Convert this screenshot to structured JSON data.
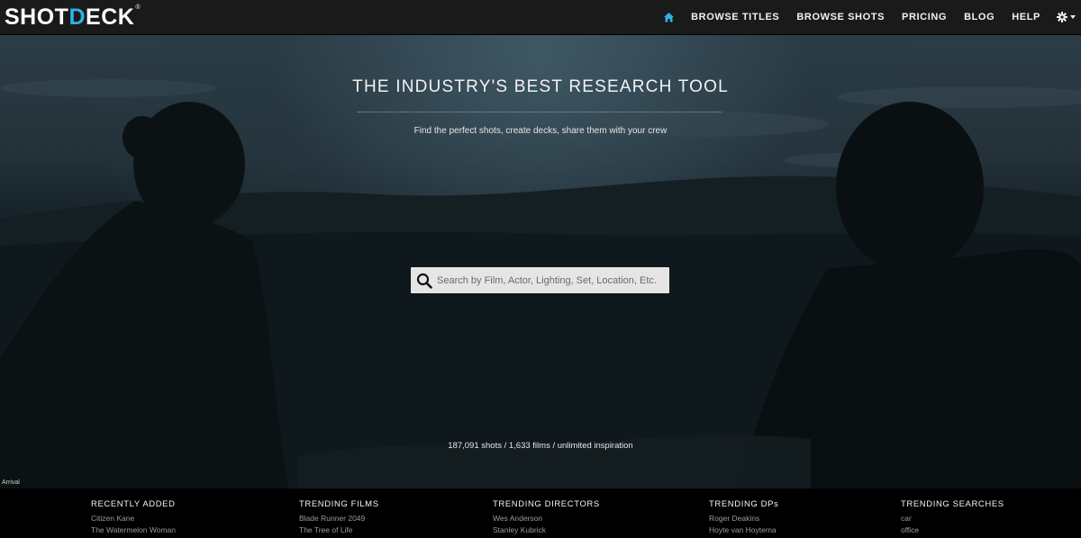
{
  "brand": {
    "logo_part1": "SHOT",
    "logo_part2": "DECK",
    "logo_mark": "®",
    "accent_color": "#2fb2e8"
  },
  "nav": {
    "home_icon": "home-icon",
    "items": [
      {
        "label": "BROWSE TITLES"
      },
      {
        "label": "BROWSE SHOTS"
      },
      {
        "label": "PRICING"
      },
      {
        "label": "BLOG"
      },
      {
        "label": "HELP"
      }
    ],
    "settings_icon": "gear-icon"
  },
  "hero": {
    "title": "THE INDUSTRY'S BEST RESEARCH TOOL",
    "subtitle": "Find the perfect shots, create decks, share them with your crew",
    "search_placeholder": "Search by Film, Actor, Lighting, Set, Location, Etc.",
    "stats": "187,091 shots / 1,633 films / unlimited inspiration",
    "caption": "Arrival"
  },
  "footer": {
    "columns": [
      {
        "heading": "RECENTLY ADDED",
        "links": [
          "Citizen Kane",
          "The Watermelon Woman"
        ]
      },
      {
        "heading": "TRENDING FILMS",
        "links": [
          "Blade Runner 2049",
          "The Tree of Life"
        ]
      },
      {
        "heading": "TRENDING DIRECTORS",
        "links": [
          "Wes Anderson",
          "Stanley Kubrick"
        ]
      },
      {
        "heading": "TRENDING DPs",
        "links": [
          "Roger Deakins",
          "Hoyte van Hoytema"
        ]
      },
      {
        "heading": "TRENDING SEARCHES",
        "links": [
          "car",
          "office"
        ]
      }
    ]
  }
}
